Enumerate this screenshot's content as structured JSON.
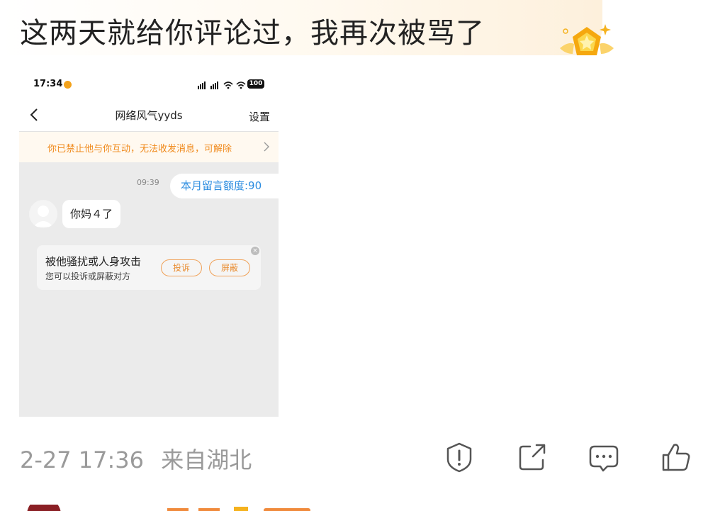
{
  "post": {
    "text": "这两天就给你评论过，我再次被骂了",
    "timestamp": "2-27 17:36",
    "location": "来自湖北"
  },
  "screenshot": {
    "status_time": "17:34",
    "battery": "100",
    "nav_title": "网络风气yyds",
    "settings_label": "设置",
    "block_notice": "你已禁止他与你互动，无法收发消息，可解除",
    "message_time": "09:39",
    "quota_text": "本月留言额度:90",
    "incoming_message": "你妈４了",
    "report_card": {
      "title": "被他骚扰或人身攻击",
      "subtitle": "您可以投诉或屏蔽对方",
      "report_label": "投诉",
      "block_label": "屏蔽"
    }
  },
  "actions": [
    "report-icon",
    "share-icon",
    "comment-icon",
    "like-icon"
  ],
  "colors": {
    "accent_orange": "#f08a1c",
    "quota_blue": "#2c8de0",
    "meta_gray": "#9a9a9a",
    "badge_gold": "#f5b21e"
  }
}
